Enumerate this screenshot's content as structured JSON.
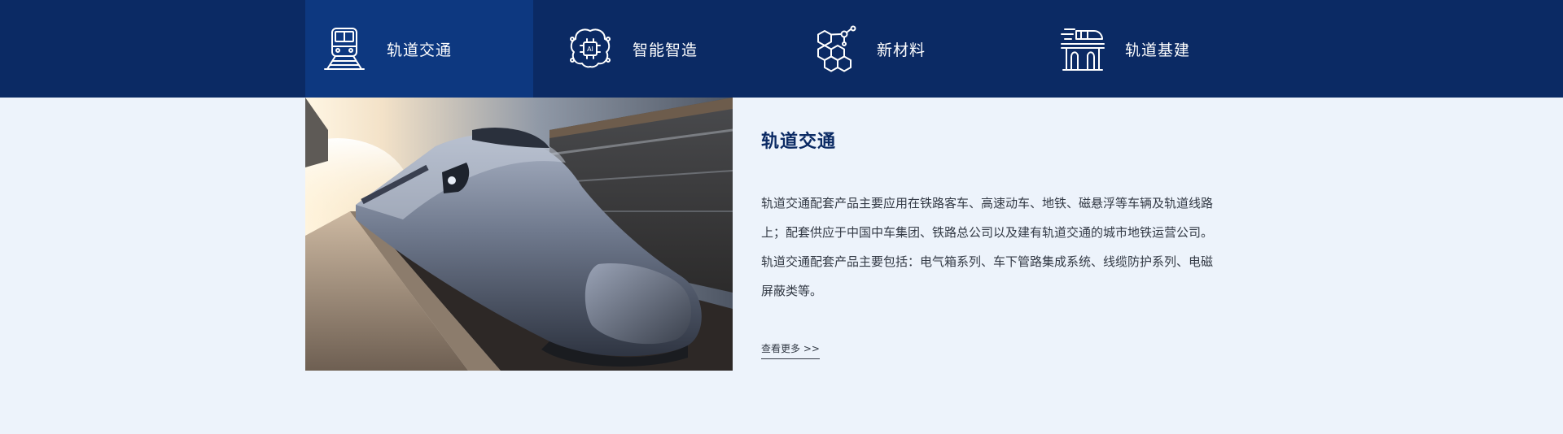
{
  "colors": {
    "nav_background": "#0b2a64",
    "nav_active": "#0d3880",
    "page_background": "#edf3fb",
    "title": "#0b2a64",
    "text": "#333a45"
  },
  "nav": {
    "tabs": [
      {
        "label": "轨道交通",
        "icon": "train-icon",
        "active": true
      },
      {
        "label": "智能智造",
        "icon": "chip-icon",
        "active": false
      },
      {
        "label": "新材料",
        "icon": "molecule-icon",
        "active": false
      },
      {
        "label": "轨道基建",
        "icon": "railway-bridge-icon",
        "active": false
      }
    ]
  },
  "content": {
    "title": "轨道交通",
    "description_lines": [
      "轨道交通配套产品主要应用在铁路客车、高速动车、地铁、磁悬浮等车辆及轨道线路",
      "上；配套供应于中国中车集团、铁路总公司以及建有轨道交通的城市地铁运营公司。",
      "轨道交通配套产品主要包括：电气箱系列、车下管路集成系统、线缆防护系列、电磁",
      "屏蔽类等。"
    ],
    "more_link": "查看更多 >>"
  }
}
